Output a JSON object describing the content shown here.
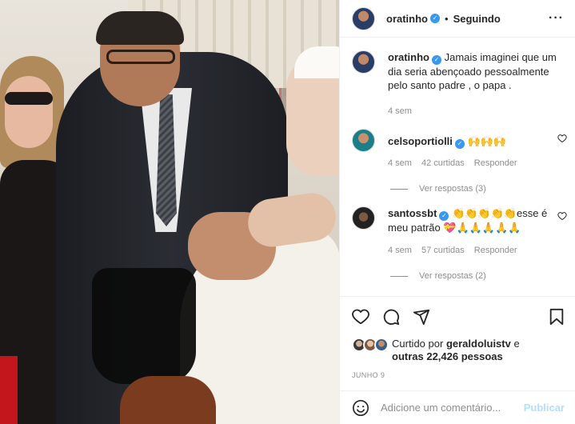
{
  "header": {
    "username": "oratinho",
    "separator": "•",
    "follow_status": "Seguindo",
    "more": "···"
  },
  "caption": {
    "username": "oratinho",
    "text": "Jamais imaginei que um dia seria abençoado pessoalmente pelo santo padre , o papa .",
    "time": "4 sem"
  },
  "comments": [
    {
      "username": "celsoportiolli",
      "text": "🙌🙌🙌",
      "time": "4 sem",
      "likes": "42 curtidas",
      "reply": "Responder",
      "view_replies": "Ver respostas (3)"
    },
    {
      "username": "santossbt",
      "text": "👏👏👏👏👏esse é meu patrão 💝🙏🙏🙏🙏🙏",
      "time": "4 sem",
      "likes": "57 curtidas",
      "reply": "Responder",
      "view_replies": "Ver respostas (2)"
    }
  ],
  "likes": {
    "prefix": "Curtido por",
    "user": "geraldoluistv",
    "conjunction": "e",
    "others": "outras 22,426 pessoas"
  },
  "date": "JUNHO 9",
  "add_comment": {
    "placeholder": "Adicione um comentário...",
    "publish": "Publicar"
  },
  "icons": [
    "heart-icon",
    "comment-icon",
    "share-icon",
    "bookmark-icon",
    "emoji-icon",
    "verified-icon",
    "more-icon"
  ]
}
